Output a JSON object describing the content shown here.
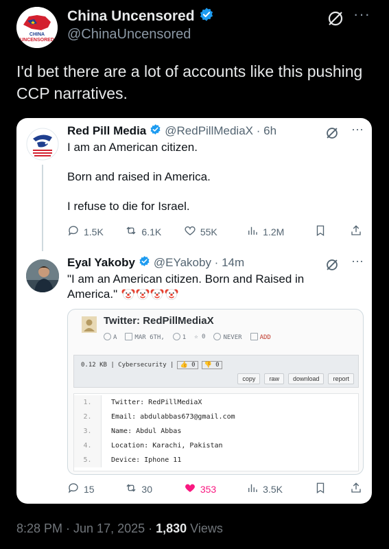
{
  "author": {
    "name": "China Uncensored",
    "handle": "@ChinaUncensored",
    "avatar_text": "CHINA UNCENSORED"
  },
  "tweet_text": "I'd bet there are a lot of accounts like this pushing CCP narratives.",
  "more_glyph": "···",
  "quoted": {
    "name": "Red Pill Media",
    "handle_time": "@RedPillMediaX · 6h",
    "lines": [
      "I am an American citizen.",
      "Born and raised in America.",
      "I refuse to die for Israel."
    ],
    "stats": {
      "replies": "1.5K",
      "reposts": "6.1K",
      "likes": "55K",
      "views": "1.2M"
    }
  },
  "reply": {
    "name": "Eyal Yakoby",
    "handle_time": "@EYakoby · 14m",
    "text": "\"I am an American citizen. Born and Raised in America.\"",
    "emoji_count": 4,
    "stats": {
      "replies": "15",
      "reposts": "30",
      "likes": "353",
      "views": "3.5K"
    }
  },
  "paste": {
    "title": "Twitter: RedPillMediaX",
    "meta": {
      "user": "A",
      "date": "MAR 6TH,",
      "views": "1",
      "rating": "0",
      "expire": "NEVER",
      "add": "ADD"
    },
    "size_cat": "0.12 KB | Cybersecurity |",
    "up": "0",
    "down": "0",
    "buttons": [
      "copy",
      "raw",
      "download",
      "report"
    ],
    "lines": [
      {
        "n": "1.",
        "t": "Twitter: RedPillMediaX"
      },
      {
        "n": "2.",
        "t": "Email: abdulabbas673@gmail.com"
      },
      {
        "n": "3.",
        "t": "Name: Abdul Abbas"
      },
      {
        "n": "4.",
        "t": "Location: Karachi, Pakistan"
      },
      {
        "n": "5.",
        "t": "Device: Iphone 11"
      }
    ]
  },
  "footer": {
    "time": "8:28 PM · Jun 17, 2025 ·",
    "views": "1,830",
    "views_label": "Views"
  },
  "colors": {
    "background": "#000000",
    "card": "#ffffff",
    "verified": "#1d9bf0",
    "like": "#f91880",
    "muted": "#71767b"
  }
}
